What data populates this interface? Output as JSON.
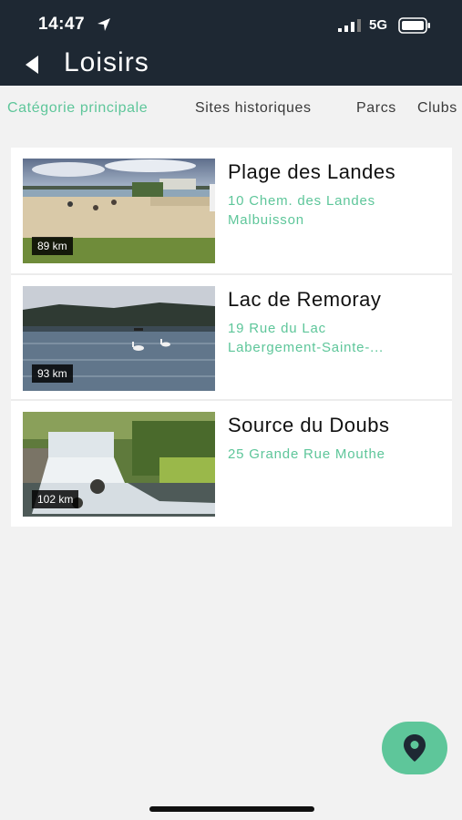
{
  "status_bar": {
    "time": "14:47",
    "network": "5G"
  },
  "header": {
    "title": "Loisirs"
  },
  "tabs": [
    {
      "label": "Catégorie principale",
      "active": true
    },
    {
      "label": "Sites historiques",
      "active": false
    },
    {
      "label": "Parcs",
      "active": false
    },
    {
      "label": "Clubs",
      "active": false
    }
  ],
  "places": [
    {
      "name": "Plage des Landes",
      "address_line1": "10 Chem. des Landes",
      "address_line2": "Malbuisson",
      "distance": "89 km"
    },
    {
      "name": "Lac de Remoray",
      "address_line1": "19 Rue du Lac",
      "address_line2": "Labergement-Sainte-...",
      "distance": "93 km"
    },
    {
      "name": "Source du Doubs",
      "address_line1": "25 Grande Rue Mouthe",
      "address_line2": "",
      "distance": "102 km"
    }
  ],
  "colors": {
    "accent": "#5ec69a",
    "header_bg": "#1e2833",
    "page_bg": "#f2f2f2"
  },
  "icons": {
    "back": "back-arrow-icon",
    "map": "map-pin-icon",
    "location": "location-arrow-icon"
  }
}
